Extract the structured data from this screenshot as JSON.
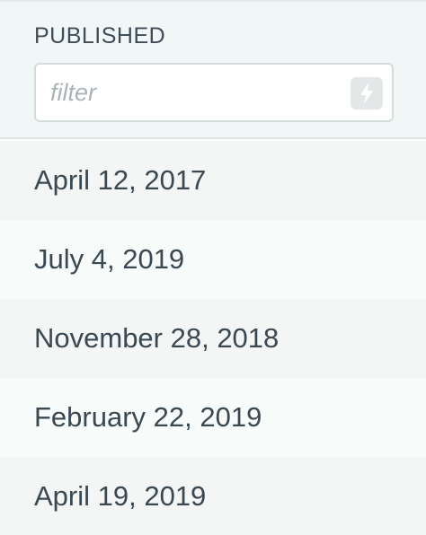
{
  "column": {
    "title": "PUBLISHED",
    "filter": {
      "value": "",
      "placeholder": "filter",
      "action_icon": "bolt-icon"
    },
    "rows": [
      "April 12, 2017",
      "July 4, 2019",
      "November 28, 2018",
      "February 22, 2019",
      "April 19, 2019"
    ]
  },
  "colors": {
    "header_bg": "#f1f7f7",
    "row_odd_bg": "#f4f5f5",
    "row_even_bg": "#f7fbfa",
    "text": "#3a4852",
    "placeholder": "#aab3b8"
  }
}
